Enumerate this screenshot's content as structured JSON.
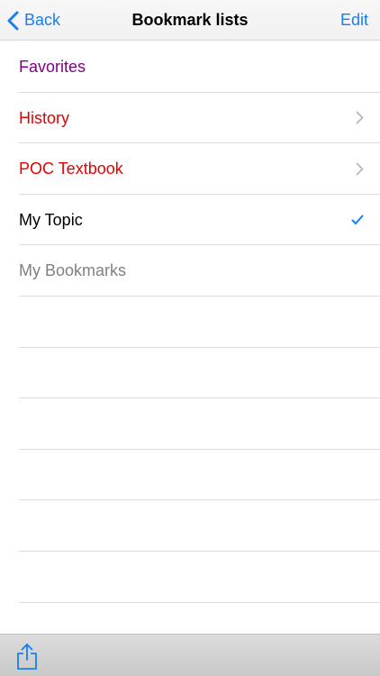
{
  "navbar": {
    "back_label": "Back",
    "title": "Bookmark lists",
    "edit_label": "Edit"
  },
  "lists": [
    {
      "label": "Favorites",
      "color": "#800080",
      "accessory": "none"
    },
    {
      "label": "History",
      "color": "#e60000",
      "accessory": "chevron-right-icon"
    },
    {
      "label": "POC Textbook",
      "color": "#e60000",
      "accessory": "chevron-right-icon"
    },
    {
      "label": "My Topic",
      "color": "#000000",
      "accessory": "checkmark-icon"
    },
    {
      "label": "My Bookmarks",
      "color": "#808080",
      "accessory": "none"
    }
  ],
  "toolbar": {
    "share_icon": "share-icon"
  },
  "colors": {
    "accent": "#1a7df0",
    "separator": "#dcdcdc",
    "chevron": "#b7b7bc"
  }
}
